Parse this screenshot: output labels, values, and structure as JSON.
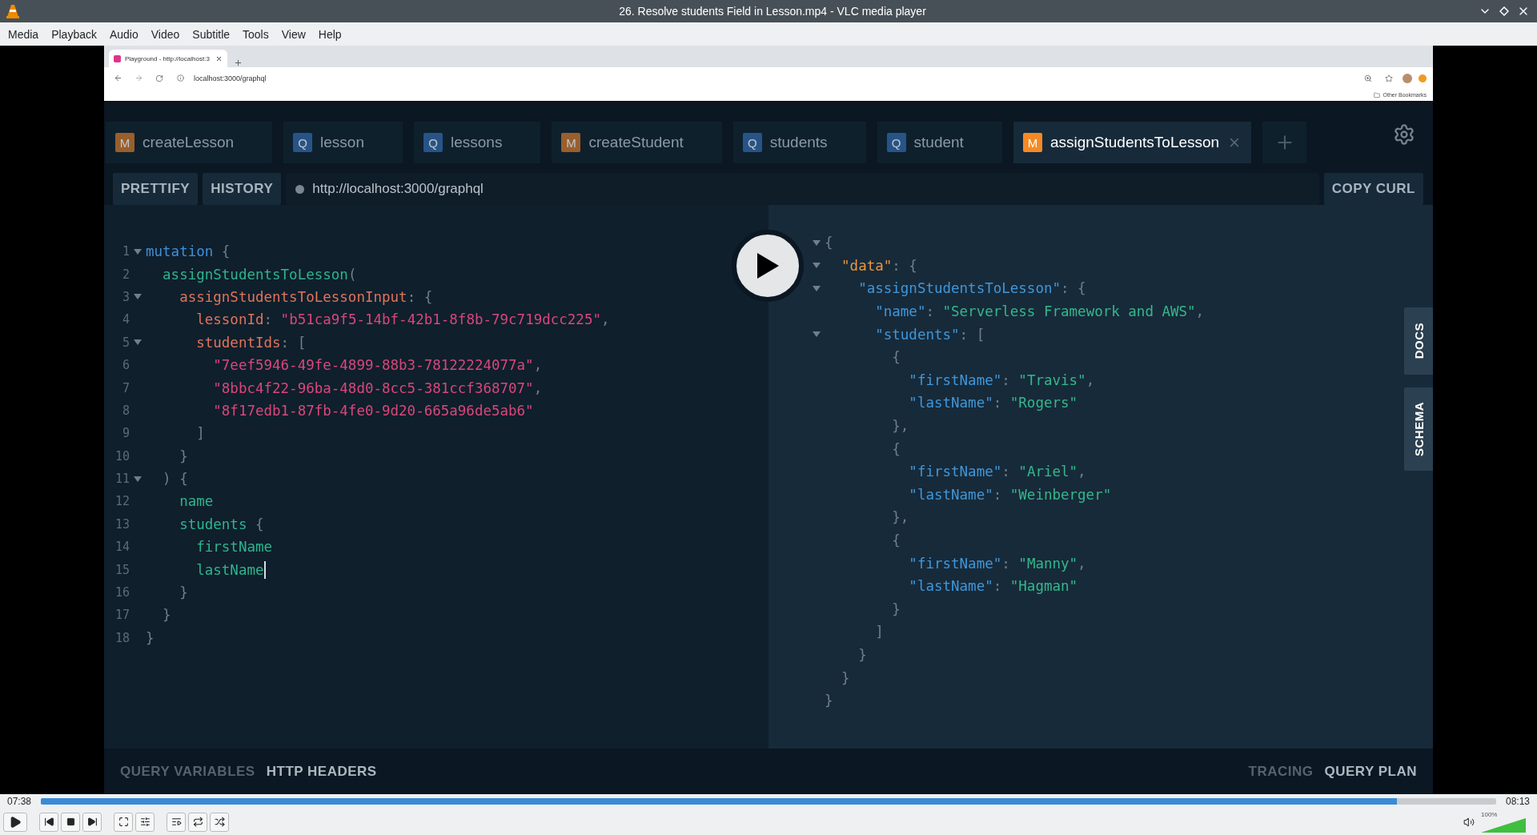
{
  "window": {
    "title": "26. Resolve students Field in Lesson.mp4 - VLC media player"
  },
  "menu": [
    "Media",
    "Playback",
    "Audio",
    "Video",
    "Subtitle",
    "Tools",
    "View",
    "Help"
  ],
  "video": {
    "browser": {
      "tab": "Playground - http://localhost:3",
      "address": "localhost:3000/graphql",
      "bookmarks": "Other Bookmarks"
    },
    "playground": {
      "tabs": [
        {
          "kind": "mutation",
          "badge": "M",
          "label": "createLesson",
          "selected": false
        },
        {
          "kind": "query",
          "badge": "Q",
          "label": "lesson",
          "selected": false
        },
        {
          "kind": "query",
          "badge": "Q",
          "label": "lessons",
          "selected": false
        },
        {
          "kind": "mutation",
          "badge": "M",
          "label": "createStudent",
          "selected": false
        },
        {
          "kind": "query",
          "badge": "Q",
          "label": "students",
          "selected": false
        },
        {
          "kind": "query",
          "badge": "Q",
          "label": "student",
          "selected": false
        },
        {
          "kind": "mutation",
          "badge": "M",
          "label": "assignStudentsToLesson",
          "selected": true
        }
      ],
      "toolbar": {
        "buttons": [
          "PRETTIFY",
          "HISTORY"
        ],
        "url": "http://localhost:3000/graphql",
        "copy": "COPY CURL"
      },
      "query": [
        {
          "n": "1",
          "fold": true,
          "cursor": false,
          "tokens": [
            {
              "kind": "keyword",
              "text": "mutation"
            },
            {
              "kind": "punct",
              "text": " {"
            }
          ]
        },
        {
          "n": "2",
          "fold": false,
          "cursor": false,
          "tokens": [
            {
              "kind": "field",
              "text": "  assignStudentsToLesson"
            },
            {
              "kind": "punct",
              "text": "("
            }
          ]
        },
        {
          "n": "3",
          "fold": true,
          "cursor": false,
          "tokens": [
            {
              "kind": "arg",
              "text": "    assignStudentsToLessonInput"
            },
            {
              "kind": "punct",
              "text": ": {"
            }
          ]
        },
        {
          "n": "4",
          "fold": false,
          "cursor": false,
          "tokens": [
            {
              "kind": "arg",
              "text": "      lessonId"
            },
            {
              "kind": "punct",
              "text": ": "
            },
            {
              "kind": "string",
              "text": "\"b51ca9f5-14bf-42b1-8f8b-79c719dcc225\""
            },
            {
              "kind": "punct",
              "text": ","
            }
          ]
        },
        {
          "n": "5",
          "fold": true,
          "cursor": false,
          "tokens": [
            {
              "kind": "arg",
              "text": "      studentIds"
            },
            {
              "kind": "punct",
              "text": ": ["
            }
          ]
        },
        {
          "n": "6",
          "fold": false,
          "cursor": false,
          "tokens": [
            {
              "kind": "string",
              "text": "        \"7eef5946-49fe-4899-88b3-78122224077a\""
            },
            {
              "kind": "punct",
              "text": ","
            }
          ]
        },
        {
          "n": "7",
          "fold": false,
          "cursor": false,
          "tokens": [
            {
              "kind": "string",
              "text": "        \"8bbc4f22-96ba-48d0-8cc5-381ccf368707\""
            },
            {
              "kind": "punct",
              "text": ","
            }
          ]
        },
        {
          "n": "8",
          "fold": false,
          "cursor": false,
          "tokens": [
            {
              "kind": "string",
              "text": "        \"8f17edb1-87fb-4fe0-9d20-665a96de5ab6\""
            }
          ]
        },
        {
          "n": "9",
          "fold": false,
          "cursor": false,
          "tokens": [
            {
              "kind": "punct",
              "text": "      ]"
            }
          ]
        },
        {
          "n": "10",
          "fold": false,
          "cursor": false,
          "tokens": [
            {
              "kind": "punct",
              "text": "    }"
            }
          ]
        },
        {
          "n": "11",
          "fold": true,
          "cursor": false,
          "tokens": [
            {
              "kind": "punct",
              "text": "  ) {"
            }
          ]
        },
        {
          "n": "12",
          "fold": false,
          "cursor": false,
          "tokens": [
            {
              "kind": "field",
              "text": "    name"
            }
          ]
        },
        {
          "n": "13",
          "fold": false,
          "cursor": false,
          "tokens": [
            {
              "kind": "field",
              "text": "    students"
            },
            {
              "kind": "punct",
              "text": " {"
            }
          ]
        },
        {
          "n": "14",
          "fold": false,
          "cursor": false,
          "tokens": [
            {
              "kind": "field",
              "text": "      firstName"
            }
          ]
        },
        {
          "n": "15",
          "fold": false,
          "cursor": true,
          "tokens": [
            {
              "kind": "field",
              "text": "      lastName"
            }
          ]
        },
        {
          "n": "16",
          "fold": false,
          "cursor": false,
          "tokens": [
            {
              "kind": "punct",
              "text": "    }"
            }
          ]
        },
        {
          "n": "17",
          "fold": false,
          "cursor": false,
          "tokens": [
            {
              "kind": "punct",
              "text": "  }"
            }
          ]
        },
        {
          "n": "18",
          "fold": false,
          "cursor": false,
          "tokens": [
            {
              "kind": "punct",
              "text": "}"
            }
          ]
        }
      ],
      "result": [
        {
          "fold": true,
          "tokens": [
            {
              "kind": "punct",
              "text": "{"
            }
          ]
        },
        {
          "fold": true,
          "tokens": [
            {
              "kind": "datakey",
              "text": "  \"data\""
            },
            {
              "kind": "punct",
              "text": ": {"
            }
          ]
        },
        {
          "fold": true,
          "tokens": [
            {
              "kind": "key",
              "text": "    \"assignStudentsToLesson\""
            },
            {
              "kind": "punct",
              "text": ": {"
            }
          ]
        },
        {
          "fold": false,
          "tokens": [
            {
              "kind": "key",
              "text": "      \"name\""
            },
            {
              "kind": "punct",
              "text": ": "
            },
            {
              "kind": "value",
              "text": "\"Serverless Framework and AWS\""
            },
            {
              "kind": "punct",
              "text": ","
            }
          ]
        },
        {
          "fold": true,
          "tokens": [
            {
              "kind": "key",
              "text": "      \"students\""
            },
            {
              "kind": "punct",
              "text": ": ["
            }
          ]
        },
        {
          "fold": false,
          "tokens": [
            {
              "kind": "punct",
              "text": "        {"
            }
          ]
        },
        {
          "fold": false,
          "tokens": [
            {
              "kind": "key",
              "text": "          \"firstName\""
            },
            {
              "kind": "punct",
              "text": ": "
            },
            {
              "kind": "value",
              "text": "\"Travis\""
            },
            {
              "kind": "punct",
              "text": ","
            }
          ]
        },
        {
          "fold": false,
          "tokens": [
            {
              "kind": "key",
              "text": "          \"lastName\""
            },
            {
              "kind": "punct",
              "text": ": "
            },
            {
              "kind": "value",
              "text": "\"Rogers\""
            }
          ]
        },
        {
          "fold": false,
          "tokens": [
            {
              "kind": "punct",
              "text": "        },"
            }
          ]
        },
        {
          "fold": false,
          "tokens": [
            {
              "kind": "punct",
              "text": "        {"
            }
          ]
        },
        {
          "fold": false,
          "tokens": [
            {
              "kind": "key",
              "text": "          \"firstName\""
            },
            {
              "kind": "punct",
              "text": ": "
            },
            {
              "kind": "value",
              "text": "\"Ariel\""
            },
            {
              "kind": "punct",
              "text": ","
            }
          ]
        },
        {
          "fold": false,
          "tokens": [
            {
              "kind": "key",
              "text": "          \"lastName\""
            },
            {
              "kind": "punct",
              "text": ": "
            },
            {
              "kind": "value",
              "text": "\"Weinberger\""
            }
          ]
        },
        {
          "fold": false,
          "tokens": [
            {
              "kind": "punct",
              "text": "        },"
            }
          ]
        },
        {
          "fold": false,
          "tokens": [
            {
              "kind": "punct",
              "text": "        {"
            }
          ]
        },
        {
          "fold": false,
          "tokens": [
            {
              "kind": "key",
              "text": "          \"firstName\""
            },
            {
              "kind": "punct",
              "text": ": "
            },
            {
              "kind": "value",
              "text": "\"Manny\""
            },
            {
              "kind": "punct",
              "text": ","
            }
          ]
        },
        {
          "fold": false,
          "tokens": [
            {
              "kind": "key",
              "text": "          \"lastName\""
            },
            {
              "kind": "punct",
              "text": ": "
            },
            {
              "kind": "value",
              "text": "\"Hagman\""
            }
          ]
        },
        {
          "fold": false,
          "tokens": [
            {
              "kind": "punct",
              "text": "        }"
            }
          ]
        },
        {
          "fold": false,
          "tokens": [
            {
              "kind": "punct",
              "text": "      ]"
            }
          ]
        },
        {
          "fold": false,
          "tokens": [
            {
              "kind": "punct",
              "text": "    }"
            }
          ]
        },
        {
          "fold": false,
          "tokens": [
            {
              "kind": "punct",
              "text": "  }"
            }
          ]
        },
        {
          "fold": false,
          "tokens": [
            {
              "kind": "punct",
              "text": "}"
            }
          ]
        }
      ],
      "side_tabs": [
        "DOCS",
        "SCHEMA"
      ],
      "bottom_left": [
        "QUERY VARIABLES",
        "HTTP HEADERS"
      ],
      "bottom_right": [
        "TRACING",
        "QUERY PLAN"
      ]
    }
  },
  "player": {
    "elapsed": "07:38",
    "total": "08:13",
    "progress": {
      "level": 0.932
    },
    "volume": {
      "reading": "100%",
      "level": 1.0
    }
  }
}
